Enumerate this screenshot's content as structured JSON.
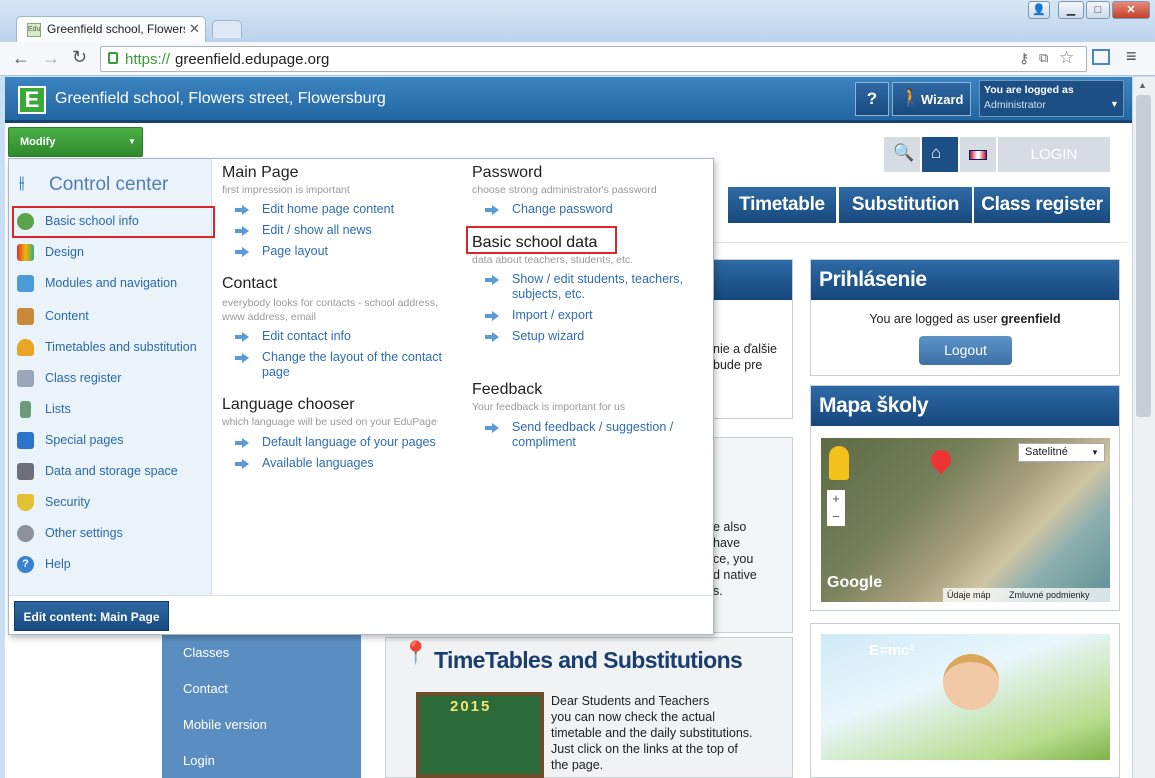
{
  "browser": {
    "tab_title": "Greenfield school, Flowers",
    "tab_favicon": "Edu",
    "url_scheme": "https://",
    "url_host": "greenfield.edupage.org"
  },
  "header": {
    "school_name": "Greenfield school, Flowers street, Flowersburg",
    "help_label": "?",
    "wizard_label": "Wizard",
    "logged_as_label": "You are logged as",
    "logged_as_value": "Administrator"
  },
  "modify_label": "Modify",
  "top_icons": {
    "login_label": "LOGIN"
  },
  "nav": [
    "Timetable",
    "Substitution",
    "Class register"
  ],
  "control_center": {
    "title": "Control center",
    "items": [
      "Basic school info",
      "Design",
      "Modules and navigation",
      "Content",
      "Timetables and substitution",
      "Class register",
      "Lists",
      "Special pages",
      "Data and storage space",
      "Security",
      "Other settings",
      "Help"
    ],
    "edit_content_button": "Edit content: Main Page"
  },
  "popup": {
    "main_page": {
      "title": "Main Page",
      "subtitle": "first impression is important",
      "links": [
        "Edit home page content",
        "Edit / show all news",
        "Page layout"
      ]
    },
    "contact": {
      "title": "Contact",
      "subtitle": "everybody looks for contacts - school address, www address, email",
      "links": [
        "Edit contact info",
        "Change the layout of the contact page"
      ]
    },
    "language": {
      "title": "Language chooser",
      "subtitle": "which language will be used on your EduPage",
      "links": [
        "Default language of your pages",
        "Available languages"
      ]
    },
    "password": {
      "title": "Password",
      "subtitle": "choose strong administrator's password",
      "links": [
        "Change password"
      ]
    },
    "basic_data": {
      "title": "Basic school data",
      "subtitle": "data about teachers, students, etc.",
      "links": [
        "Show / edit students, teachers, subjects, etc.",
        "Import / export",
        "Setup wizard"
      ]
    },
    "feedback": {
      "title": "Feedback",
      "subtitle": "Your feedback is important for us",
      "links": [
        "Send feedback / suggestion / compliment"
      ]
    }
  },
  "login_panel": {
    "title": "Prihlásenie",
    "text_prefix": "You are logged as user",
    "user": "greenfield",
    "logout_label": "Logout"
  },
  "map_panel": {
    "title": "Mapa školy",
    "map_type": "Satelitné",
    "zoom_in": "+",
    "zoom_out": "−",
    "google": "Google",
    "data_label": "Údaje máp",
    "terms_label": "Zmluvné podmienky"
  },
  "left_menu": [
    "Classes",
    "Contact",
    "Mobile version",
    "Login"
  ],
  "partial_text": {
    "welcome_tail": [
      "nie a ďalšie",
      "bude pre"
    ],
    "mid_tail": [
      "e also",
      "have",
      "ce, you",
      "d native",
      "s."
    ]
  },
  "timetables_article": {
    "title": "TimeTables and Substitutions",
    "body": [
      "Dear Students and Teachers",
      "you can now check the actual",
      "timetable and the daily substitutions.",
      "Just click on the links at the top of",
      "the page."
    ],
    "board_year": "2015"
  },
  "promo_formula": "E=mc²",
  "colors": {
    "header": "#2266a3",
    "nav": "#174a7e",
    "link": "#2d6db0",
    "modify": "#3e9a3a",
    "highlight": "#d9262c"
  }
}
